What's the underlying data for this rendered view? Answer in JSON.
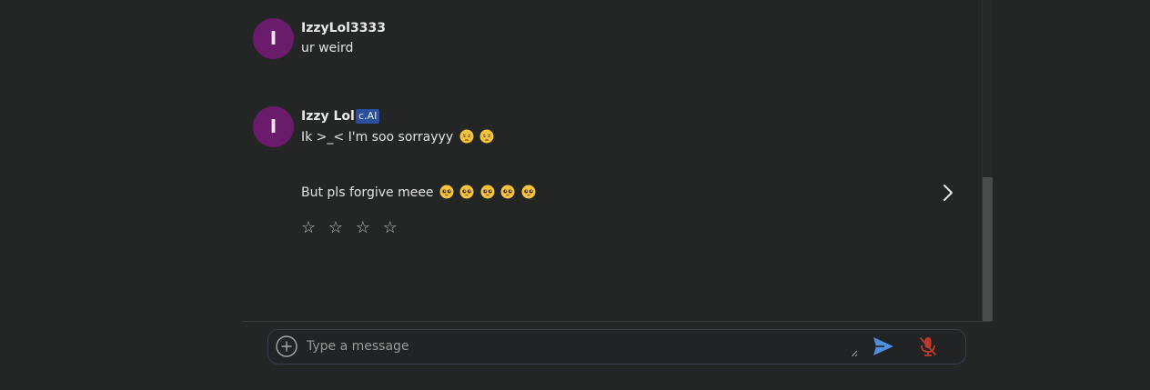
{
  "messages": [
    {
      "avatar_letter": "I",
      "username": "IzzyLol3333",
      "badge": "",
      "lines": [
        "ur weird"
      ]
    },
    {
      "avatar_letter": "I",
      "username": "Izzy Lol",
      "badge": "c.AI",
      "lines": [
        "Ik >_< I'm soo sorrayyy ",
        "But pls forgive meee "
      ],
      "line1_emoji": [
        "pensive-face",
        "pensive-face"
      ],
      "line2_emoji": [
        "pleading-face",
        "pleading-face",
        "pleading-face",
        "pleading-face",
        "pleading-face"
      ]
    }
  ],
  "rating": {
    "stars": [
      "☆",
      "☆",
      "☆",
      "☆"
    ]
  },
  "composer": {
    "placeholder": "Type a message"
  },
  "colors": {
    "background": "#242525",
    "avatar": "#6a1b6b",
    "badge": "#2b4f9e",
    "send_icon": "#4f8fe0",
    "mic_icon": "#c0392b"
  },
  "icons": {
    "add": "plus-circle-icon",
    "send": "send-icon",
    "mic": "mic-off-icon",
    "next": "chevron-right-icon"
  }
}
